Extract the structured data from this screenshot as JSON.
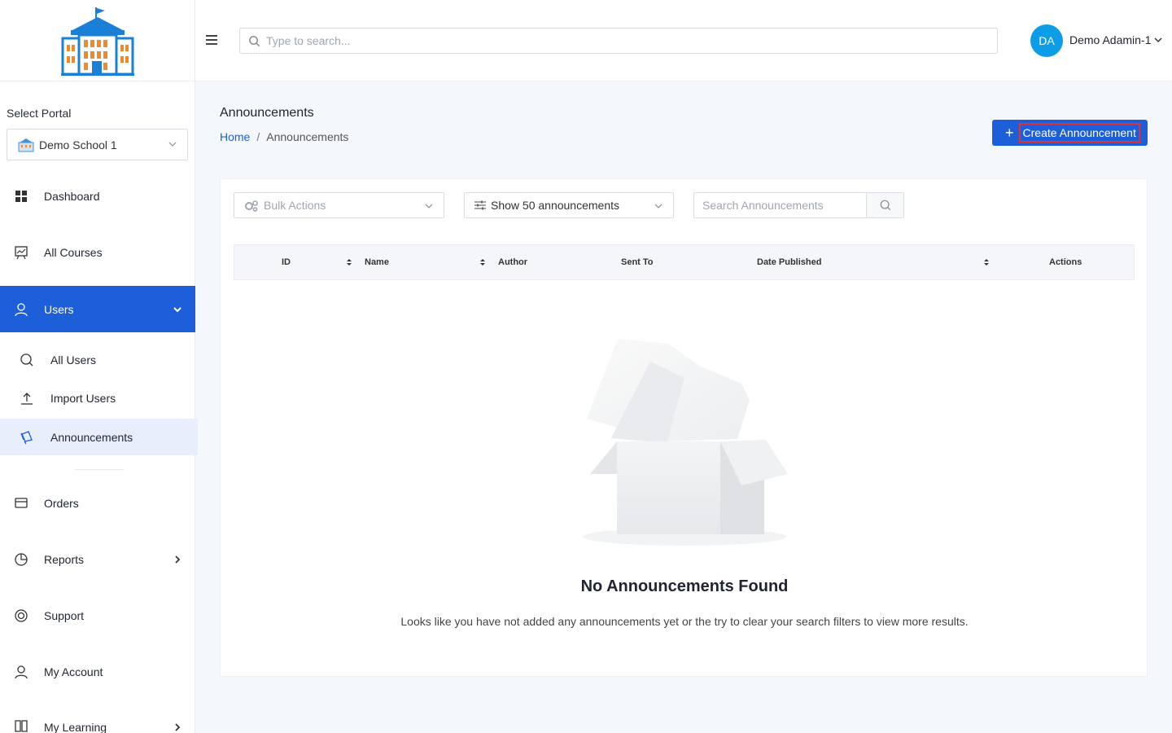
{
  "sidebar": {
    "portal_label": "Select Portal",
    "portal_value": "Demo School 1",
    "nav": [
      {
        "label": "Dashboard",
        "icon": "grid-icon"
      },
      {
        "label": "All Courses",
        "icon": "chart-board-icon"
      },
      {
        "label": "Users",
        "icon": "user-icon"
      },
      {
        "label": "Orders",
        "icon": "card-icon"
      },
      {
        "label": "Reports",
        "icon": "pie-icon"
      },
      {
        "label": "Support",
        "icon": "lifebuoy-icon"
      },
      {
        "label": "My Account",
        "icon": "user-icon"
      },
      {
        "label": "My Learning",
        "icon": "book-icon"
      }
    ],
    "users_sub": [
      {
        "label": "All Users",
        "icon": "search-icon"
      },
      {
        "label": "Import Users",
        "icon": "upload-icon"
      },
      {
        "label": "Announcements",
        "icon": "megaphone-icon"
      }
    ]
  },
  "topbar": {
    "search_placeholder": "Type to search...",
    "avatar_initials": "DA",
    "user_name": "Demo Adamin-1"
  },
  "page": {
    "title": "Announcements",
    "breadcrumb": {
      "home": "Home",
      "sep": "/",
      "current": "Announcements"
    },
    "create_button": "Create Announcement"
  },
  "toolbar": {
    "bulk_actions": "Bulk Actions",
    "show_count": "Show 50 announcements",
    "search_placeholder": "Search Announcements"
  },
  "table": {
    "columns": [
      "ID",
      "Name",
      "Author",
      "Sent To",
      "Date Published",
      "Actions"
    ]
  },
  "empty": {
    "title": "No Announcements Found",
    "message": "Looks like you have not added any announcements yet or the try to clear your search filters to view more results."
  },
  "colors": {
    "primary": "#1d5fd8",
    "avatar": "#0d9de6",
    "highlight_border": "#e0303a"
  }
}
